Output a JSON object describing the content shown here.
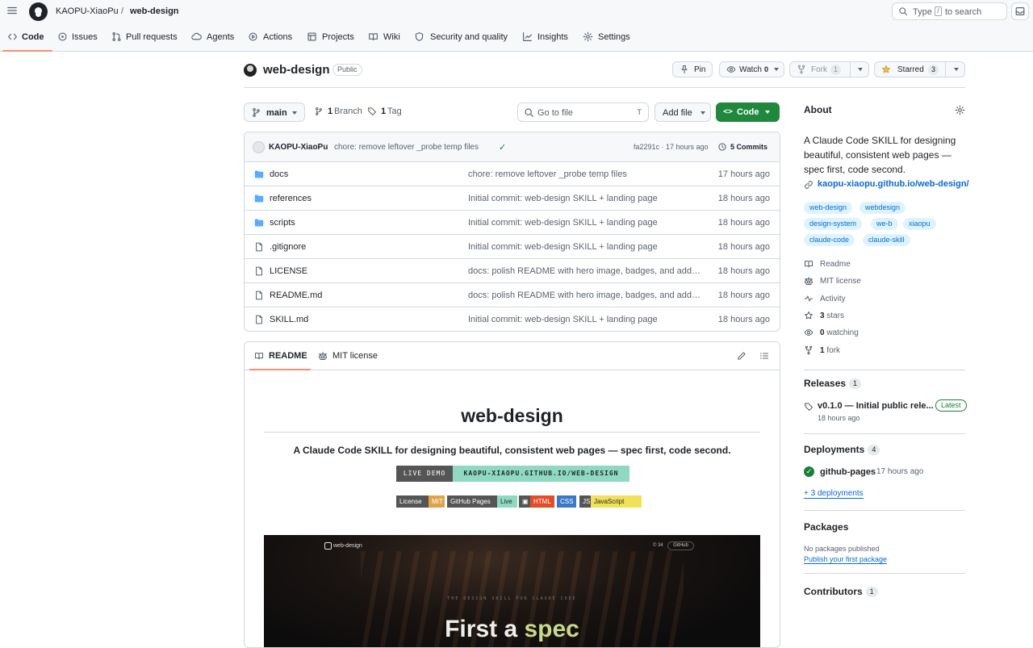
{
  "header": {
    "owner": "KAOPU-XiaoPu",
    "slash": "/",
    "repo": "web-design",
    "search_type": "Type",
    "search_key": "/",
    "search_rest": "to search"
  },
  "nav": {
    "tabs": [
      {
        "label": "Code",
        "icon": "code-icon"
      },
      {
        "label": "Issues",
        "icon": "issue-icon"
      },
      {
        "label": "Pull requests",
        "icon": "pull-request-icon"
      },
      {
        "label": "Agents",
        "icon": "agent-icon"
      },
      {
        "label": "Actions",
        "icon": "play-icon"
      },
      {
        "label": "Projects",
        "icon": "table-icon"
      },
      {
        "label": "Wiki",
        "icon": "book-icon"
      },
      {
        "label": "Security and quality",
        "icon": "shield-icon"
      },
      {
        "label": "Insights",
        "icon": "graph-icon"
      },
      {
        "label": "Settings",
        "icon": "gear-icon"
      }
    ]
  },
  "repo": {
    "name": "web-design",
    "visibility": "Public",
    "pin": "Pin",
    "watch": "Watch",
    "watch_count": "0",
    "fork": "Fork",
    "fork_count": "1",
    "starred": "Starred",
    "star_count": "3"
  },
  "filebar": {
    "branch": "main",
    "branch_count": "1",
    "branch_label": "Branch",
    "tag_count": "1",
    "tag_label": "Tag",
    "goto_placeholder": "Go to file",
    "goto_key": "T",
    "add_file": "Add file",
    "code": "Code"
  },
  "commit": {
    "author": "KAOPU-XiaoPu",
    "message": "chore: remove leftover _probe temp files",
    "check": "✓",
    "sha_time": "fa2291c · 17 hours ago",
    "commits": "5 Commits"
  },
  "files": [
    {
      "name": "docs",
      "type": "dir",
      "message": "chore: remove leftover _probe temp files",
      "age": "17 hours ago"
    },
    {
      "name": "references",
      "type": "dir",
      "message": "Initial commit: web-design SKILL + landing page",
      "age": "18 hours ago"
    },
    {
      "name": "scripts",
      "type": "dir",
      "message": "Initial commit: web-design SKILL + landing page",
      "age": "18 hours ago"
    },
    {
      "name": ".gitignore",
      "type": "file",
      "message": "Initial commit: web-design SKILL + landing page",
      "age": "18 hours ago"
    },
    {
      "name": "LICENSE",
      "type": "file",
      "message": "docs: polish README with hero image, badges, and add M...",
      "age": "18 hours ago"
    },
    {
      "name": "README.md",
      "type": "file",
      "message": "docs: polish README with hero image, badges, and add M...",
      "age": "18 hours ago"
    },
    {
      "name": "SKILL.md",
      "type": "file",
      "message": "Initial commit: web-design SKILL + landing page",
      "age": "18 hours ago"
    }
  ],
  "readme": {
    "tab_readme": "README",
    "tab_license": "MIT license",
    "title": "web-design",
    "subtitle": "A Claude Code SKILL for designing beautiful, consistent web pages — spec first, code second.",
    "demo_label": "LIVE DEMO",
    "demo_url": "KAOPU-XIAOPU.GITHUB.IO/WEB-DESIGN",
    "badges": [
      {
        "a": "License",
        "b": "MIT",
        "color": "#e0a34a"
      },
      {
        "a": "GitHub Pages",
        "b": "Live",
        "color": "#8fd9c2"
      },
      {
        "a": "▣",
        "b": "HTML",
        "color": "#e34c26"
      },
      {
        "a": "",
        "b": "CSS",
        "color": "#3c78c8"
      },
      {
        "a": "JS",
        "b": "JavaScript",
        "color": "#f1e05a"
      }
    ],
    "shot": {
      "logo": "web-design",
      "right": "© 34",
      "gh": "GitHub",
      "tagline": "THE DESIGN SKILL FOR CLAUDE CODE",
      "headline_a": "First a ",
      "headline_b": "spec"
    }
  },
  "about": {
    "title": "About",
    "description": "A Claude Code SKILL for designing beautiful, consistent web pages — spec first, code second.",
    "link": "kaopu-xiaopu.github.io/web-design/",
    "topics": [
      "web-design",
      "webdesign",
      "design-system",
      "we-b",
      "xiaopu",
      "claude-code",
      "claude-skill"
    ],
    "meta": [
      {
        "icon": "book-icon",
        "text": "Readme",
        "bold": ""
      },
      {
        "icon": "law-icon",
        "text": "MIT license",
        "bold": ""
      },
      {
        "icon": "pulse-icon",
        "text": "Activity",
        "bold": ""
      },
      {
        "icon": "star-icon",
        "text": " stars",
        "bold": "3"
      },
      {
        "icon": "eye-icon",
        "text": " watching",
        "bold": "0"
      },
      {
        "icon": "fork-icon",
        "text": " fork",
        "bold": "1"
      }
    ]
  },
  "releases": {
    "title": "Releases",
    "count": "1",
    "name": "v0.1.0 — Initial public rele...",
    "latest": "Latest",
    "date": "18 hours ago"
  },
  "deployments": {
    "title": "Deployments",
    "count": "4",
    "name": "github-pages",
    "time": "17 hours ago",
    "more": "+ 3 deployments"
  },
  "packages": {
    "title": "Packages",
    "none": "No packages published",
    "publish": "Publish your first package"
  },
  "contributors": {
    "title": "Contributors",
    "count": "1"
  },
  "colors": {
    "accent": "#fd8c73",
    "green": "#1f883d",
    "link": "#0969da",
    "folder": "#54aeff"
  }
}
